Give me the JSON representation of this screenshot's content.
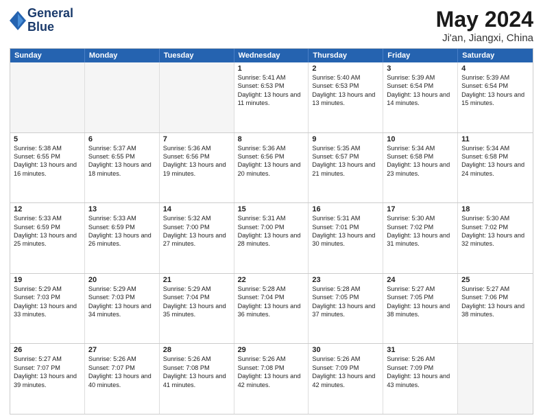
{
  "header": {
    "logo_line1": "General",
    "logo_line2": "Blue",
    "main_title": "May 2024",
    "subtitle": "Ji'an, Jiangxi, China"
  },
  "weekdays": [
    "Sunday",
    "Monday",
    "Tuesday",
    "Wednesday",
    "Thursday",
    "Friday",
    "Saturday"
  ],
  "rows": [
    [
      {
        "day": "",
        "text": "",
        "empty": true
      },
      {
        "day": "",
        "text": "",
        "empty": true
      },
      {
        "day": "",
        "text": "",
        "empty": true
      },
      {
        "day": "1",
        "text": "Sunrise: 5:41 AM\nSunset: 6:53 PM\nDaylight: 13 hours and 11 minutes."
      },
      {
        "day": "2",
        "text": "Sunrise: 5:40 AM\nSunset: 6:53 PM\nDaylight: 13 hours and 13 minutes."
      },
      {
        "day": "3",
        "text": "Sunrise: 5:39 AM\nSunset: 6:54 PM\nDaylight: 13 hours and 14 minutes."
      },
      {
        "day": "4",
        "text": "Sunrise: 5:39 AM\nSunset: 6:54 PM\nDaylight: 13 hours and 15 minutes."
      }
    ],
    [
      {
        "day": "5",
        "text": "Sunrise: 5:38 AM\nSunset: 6:55 PM\nDaylight: 13 hours and 16 minutes."
      },
      {
        "day": "6",
        "text": "Sunrise: 5:37 AM\nSunset: 6:55 PM\nDaylight: 13 hours and 18 minutes."
      },
      {
        "day": "7",
        "text": "Sunrise: 5:36 AM\nSunset: 6:56 PM\nDaylight: 13 hours and 19 minutes."
      },
      {
        "day": "8",
        "text": "Sunrise: 5:36 AM\nSunset: 6:56 PM\nDaylight: 13 hours and 20 minutes."
      },
      {
        "day": "9",
        "text": "Sunrise: 5:35 AM\nSunset: 6:57 PM\nDaylight: 13 hours and 21 minutes."
      },
      {
        "day": "10",
        "text": "Sunrise: 5:34 AM\nSunset: 6:58 PM\nDaylight: 13 hours and 23 minutes."
      },
      {
        "day": "11",
        "text": "Sunrise: 5:34 AM\nSunset: 6:58 PM\nDaylight: 13 hours and 24 minutes."
      }
    ],
    [
      {
        "day": "12",
        "text": "Sunrise: 5:33 AM\nSunset: 6:59 PM\nDaylight: 13 hours and 25 minutes."
      },
      {
        "day": "13",
        "text": "Sunrise: 5:33 AM\nSunset: 6:59 PM\nDaylight: 13 hours and 26 minutes."
      },
      {
        "day": "14",
        "text": "Sunrise: 5:32 AM\nSunset: 7:00 PM\nDaylight: 13 hours and 27 minutes."
      },
      {
        "day": "15",
        "text": "Sunrise: 5:31 AM\nSunset: 7:00 PM\nDaylight: 13 hours and 28 minutes."
      },
      {
        "day": "16",
        "text": "Sunrise: 5:31 AM\nSunset: 7:01 PM\nDaylight: 13 hours and 30 minutes."
      },
      {
        "day": "17",
        "text": "Sunrise: 5:30 AM\nSunset: 7:02 PM\nDaylight: 13 hours and 31 minutes."
      },
      {
        "day": "18",
        "text": "Sunrise: 5:30 AM\nSunset: 7:02 PM\nDaylight: 13 hours and 32 minutes."
      }
    ],
    [
      {
        "day": "19",
        "text": "Sunrise: 5:29 AM\nSunset: 7:03 PM\nDaylight: 13 hours and 33 minutes."
      },
      {
        "day": "20",
        "text": "Sunrise: 5:29 AM\nSunset: 7:03 PM\nDaylight: 13 hours and 34 minutes."
      },
      {
        "day": "21",
        "text": "Sunrise: 5:29 AM\nSunset: 7:04 PM\nDaylight: 13 hours and 35 minutes."
      },
      {
        "day": "22",
        "text": "Sunrise: 5:28 AM\nSunset: 7:04 PM\nDaylight: 13 hours and 36 minutes."
      },
      {
        "day": "23",
        "text": "Sunrise: 5:28 AM\nSunset: 7:05 PM\nDaylight: 13 hours and 37 minutes."
      },
      {
        "day": "24",
        "text": "Sunrise: 5:27 AM\nSunset: 7:05 PM\nDaylight: 13 hours and 38 minutes."
      },
      {
        "day": "25",
        "text": "Sunrise: 5:27 AM\nSunset: 7:06 PM\nDaylight: 13 hours and 38 minutes."
      }
    ],
    [
      {
        "day": "26",
        "text": "Sunrise: 5:27 AM\nSunset: 7:07 PM\nDaylight: 13 hours and 39 minutes."
      },
      {
        "day": "27",
        "text": "Sunrise: 5:26 AM\nSunset: 7:07 PM\nDaylight: 13 hours and 40 minutes."
      },
      {
        "day": "28",
        "text": "Sunrise: 5:26 AM\nSunset: 7:08 PM\nDaylight: 13 hours and 41 minutes."
      },
      {
        "day": "29",
        "text": "Sunrise: 5:26 AM\nSunset: 7:08 PM\nDaylight: 13 hours and 42 minutes."
      },
      {
        "day": "30",
        "text": "Sunrise: 5:26 AM\nSunset: 7:09 PM\nDaylight: 13 hours and 42 minutes."
      },
      {
        "day": "31",
        "text": "Sunrise: 5:26 AM\nSunset: 7:09 PM\nDaylight: 13 hours and 43 minutes."
      },
      {
        "day": "",
        "text": "",
        "empty": true
      }
    ]
  ]
}
